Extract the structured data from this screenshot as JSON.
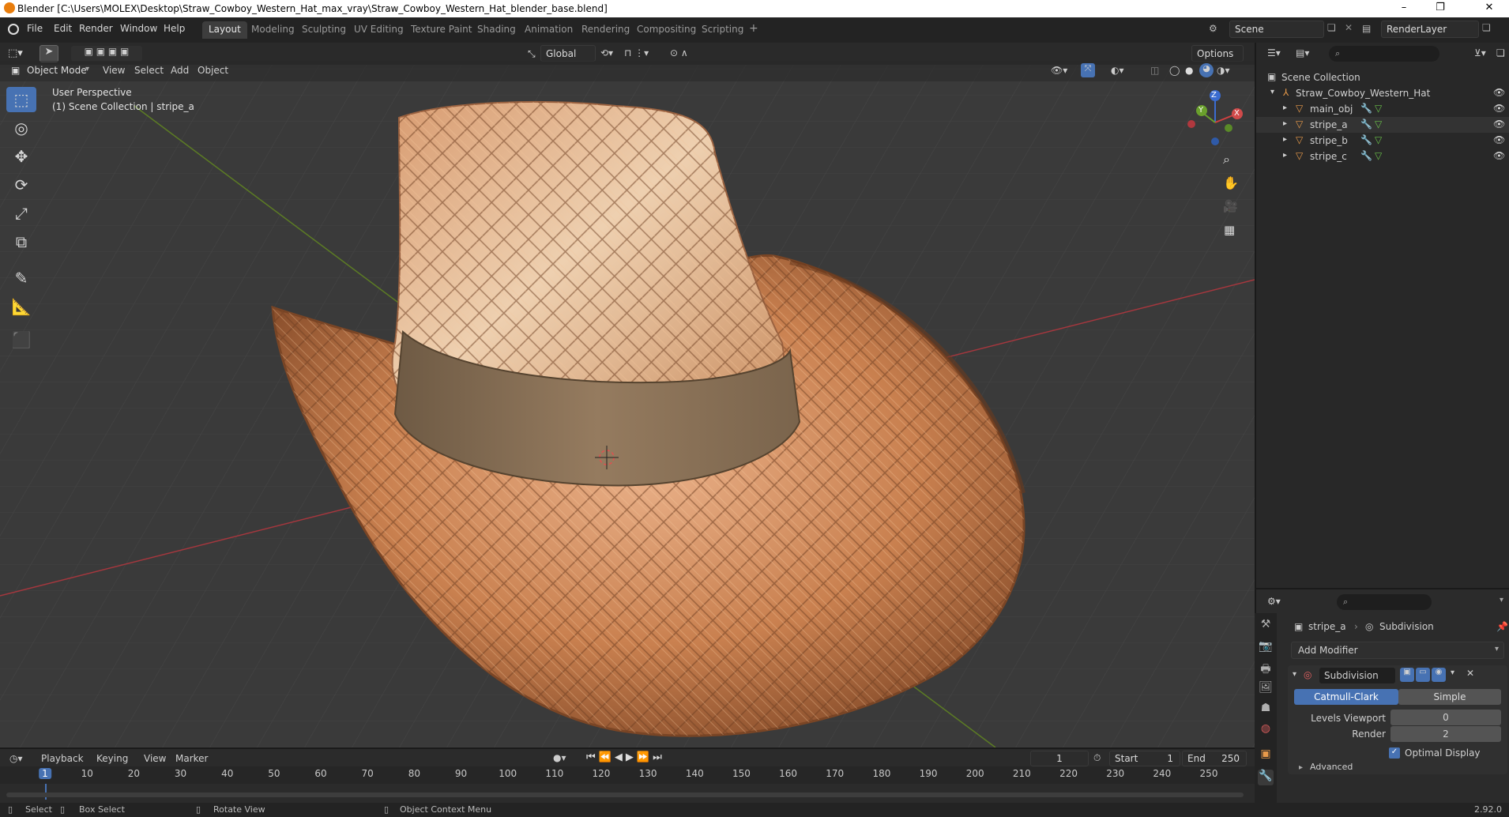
{
  "window": {
    "title": "Blender [C:\\Users\\MOLEX\\Desktop\\Straw_Cowboy_Western_Hat_max_vray\\Straw_Cowboy_Western_Hat_blender_base.blend]",
    "minimize": "–",
    "maximize": "❐",
    "close": "✕"
  },
  "menu": [
    "File",
    "Edit",
    "Render",
    "Window",
    "Help"
  ],
  "workspaces": [
    "Layout",
    "Modeling",
    "Sculpting",
    "UV Editing",
    "Texture Paint",
    "Shading",
    "Animation",
    "Rendering",
    "Compositing",
    "Scripting"
  ],
  "active_workspace": "Layout",
  "scene": {
    "label": "Scene",
    "render_layer": "RenderLayer"
  },
  "viewport_header": {
    "transform_orientation": "Global",
    "options": "Options",
    "mode": "Object Mode",
    "menus": [
      "View",
      "Select",
      "Add",
      "Object"
    ]
  },
  "viewport": {
    "perspective": "User Perspective",
    "collection_info": "(1) Scene Collection | stripe_a",
    "gizmo": {
      "x": "X",
      "y": "Y",
      "z": "Z"
    }
  },
  "outliner": {
    "root": "Scene Collection",
    "collection": "Straw_Cowboy_Western_Hat",
    "objects": [
      "main_obj",
      "stripe_a",
      "stripe_b",
      "stripe_c"
    ]
  },
  "properties": {
    "object": "stripe_a",
    "modifier_context": "Subdivision",
    "add_modifier": "Add Modifier",
    "modifier": {
      "name": "Subdivision",
      "type_a": "Catmull-Clark",
      "type_b": "Simple",
      "levels_viewport_label": "Levels Viewport",
      "levels_viewport": "0",
      "render_label": "Render",
      "render": "2",
      "optimal_display": "Optimal Display",
      "advanced": "Advanced"
    }
  },
  "timeline": {
    "menus": [
      "Playback",
      "Keying",
      "View",
      "Marker"
    ],
    "current_frame": "1",
    "start_label": "Start",
    "start": "1",
    "end_label": "End",
    "end": "250",
    "ticks": [
      "1",
      "10",
      "20",
      "30",
      "40",
      "50",
      "60",
      "70",
      "80",
      "90",
      "100",
      "110",
      "120",
      "130",
      "140",
      "150",
      "160",
      "170",
      "180",
      "190",
      "200",
      "210",
      "220",
      "230",
      "240",
      "250"
    ]
  },
  "statusbar": {
    "select": "Select",
    "box_select": "Box Select",
    "rotate_view": "Rotate View",
    "context_menu": "Object Context Menu",
    "version": "2.92.0"
  },
  "colors": {
    "accent": "#4772b3",
    "straw": "#c8865a",
    "band": "#8a7258",
    "grid_red": "#b0373f",
    "grid_green": "#6a8a2a"
  }
}
